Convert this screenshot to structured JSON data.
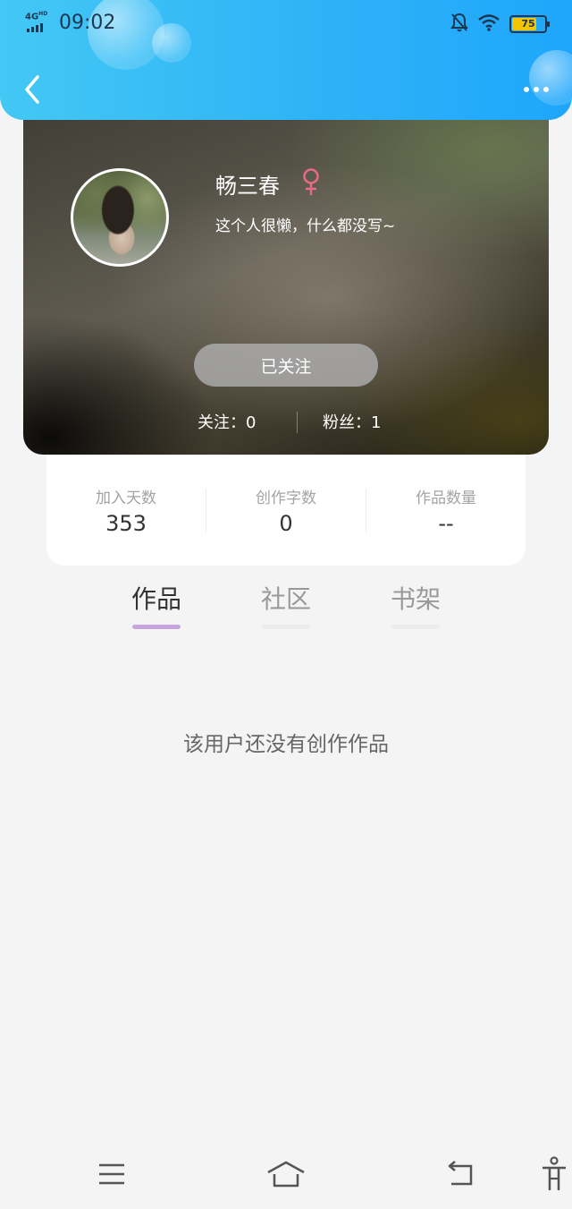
{
  "status_bar": {
    "network": "4G",
    "network_sup": "HD",
    "time": "09:02",
    "battery": "75",
    "battery_fraction": 0.75
  },
  "header": {
    "back_icon": "chevron-left-icon",
    "more_icon": "more-dots-icon"
  },
  "profile": {
    "name": "畅三春",
    "gender_symbol": "♀",
    "gender_color": "#e86b84",
    "bio": "这个人很懒，什么都没写~",
    "follow_button": "已关注",
    "following_text": "关注：0",
    "fans_text": "粉丝：1"
  },
  "stats": [
    {
      "label": "加入天数",
      "value": "353"
    },
    {
      "label": "创作字数",
      "value": "0"
    },
    {
      "label": "作品数量",
      "value": "--"
    }
  ],
  "tabs": [
    {
      "label": "作品",
      "active": true
    },
    {
      "label": "社区",
      "active": false
    },
    {
      "label": "书架",
      "active": false
    }
  ],
  "empty_message": "该用户还没有创作作品",
  "colors": {
    "header_gradient_start": "#43c8f5",
    "header_gradient_end": "#1ea6fb",
    "tab_underline_active": "#c7a6e0"
  },
  "bottom_nav": [
    "menu-icon",
    "home-icon",
    "back-icon",
    "accessibility-icon"
  ]
}
